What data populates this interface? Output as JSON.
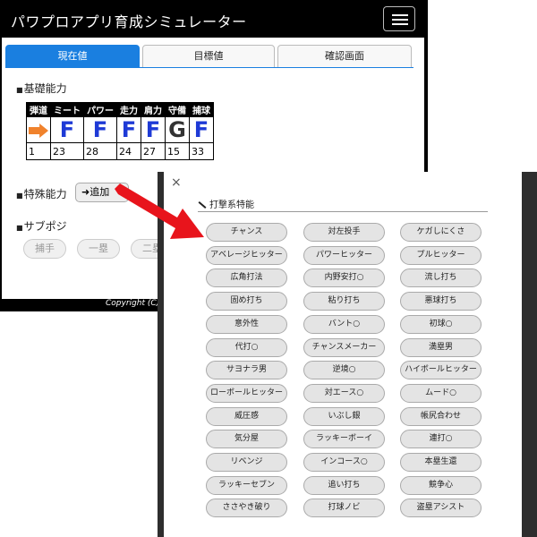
{
  "app": {
    "title": "パワプロアプリ育成シミュレーター",
    "tabs": [
      "現在値",
      "目標値",
      "確認画面"
    ],
    "basic_ability_title": "基礎能力",
    "stats_headers": [
      "弾道",
      "ミート",
      "パワー",
      "走力",
      "肩力",
      "守備",
      "捕球"
    ],
    "stats_grades": [
      "",
      "F",
      "F",
      "F",
      "F",
      "G",
      "F"
    ],
    "stats_values": [
      "1",
      "23",
      "28",
      "24",
      "27",
      "15",
      "33"
    ],
    "special_ability_title": "特殊能力",
    "add_button": "追加",
    "sub_position_title": "サブポジ",
    "sub_positions": [
      "捕手",
      "一塁",
      "二塁"
    ],
    "copyright": "Copyright (C)"
  },
  "modal": {
    "close": "×",
    "section_title": "打撃系特能",
    "skills": [
      [
        "チャンス",
        "対左投手",
        "ケガしにくさ"
      ],
      [
        "アベレージヒッター",
        "パワーヒッター",
        "プルヒッター"
      ],
      [
        "広角打法",
        "内野安打○",
        "流し打ち"
      ],
      [
        "固め打ち",
        "粘り打ち",
        "悪球打ち"
      ],
      [
        "意外性",
        "バント○",
        "初球○"
      ],
      [
        "代打○",
        "チャンスメーカー",
        "満塁男"
      ],
      [
        "サヨナラ男",
        "逆境○",
        "ハイボールヒッター"
      ],
      [
        "ローボールヒッター",
        "対エース○",
        "ムード○"
      ],
      [
        "威圧感",
        "いぶし銀",
        "帳尻合わせ"
      ],
      [
        "気分屋",
        "ラッキーボーイ",
        "連打○"
      ],
      [
        "リベンジ",
        "インコース○",
        "本塁生還"
      ],
      [
        "ラッキーセブン",
        "追い打ち",
        "競争心"
      ],
      [
        "ささやき破り",
        "打球ノビ",
        "盗塁アシスト"
      ]
    ]
  },
  "colors": {
    "accent": "#1a7fe0",
    "grade_f": "#1e3ad6",
    "arrow_overlay": "#e8141c",
    "trajectory_arrow": "#f0822c"
  }
}
